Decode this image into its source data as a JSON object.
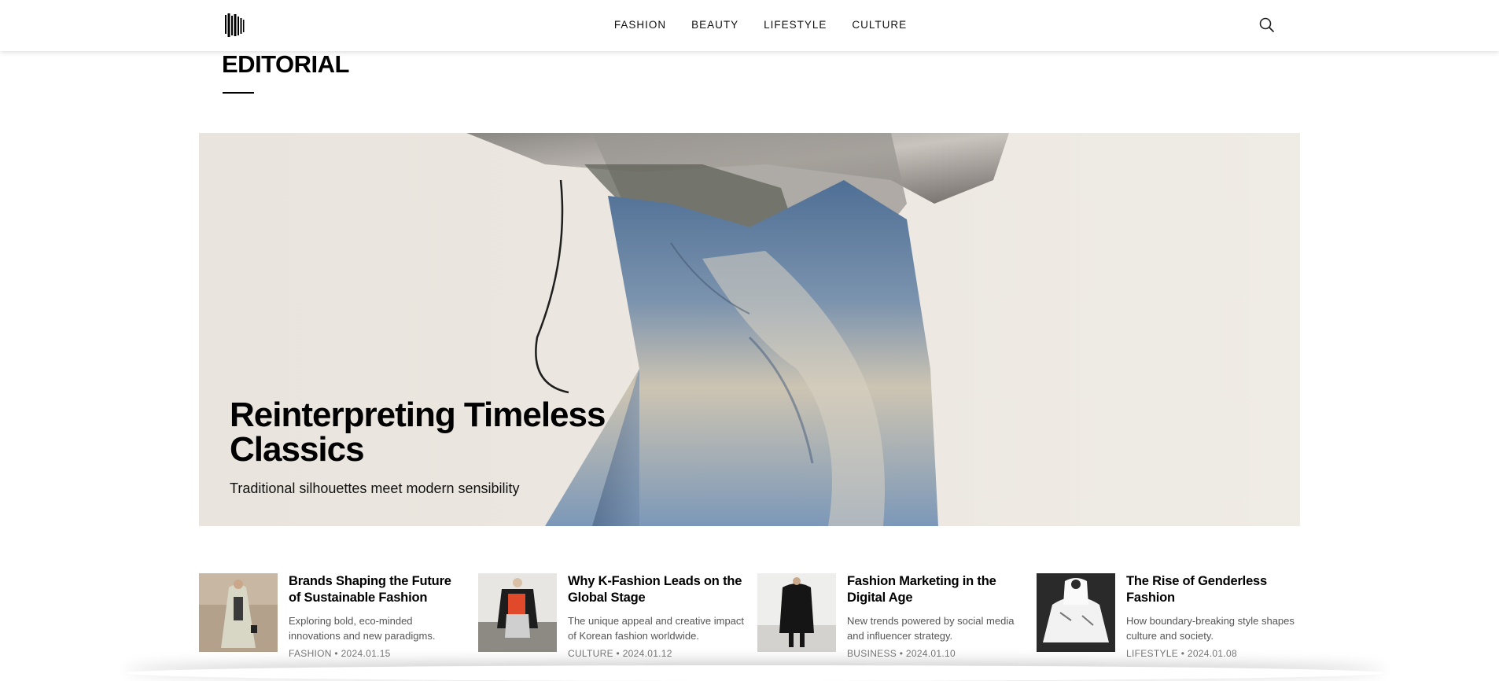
{
  "header": {
    "logo_icon": "barcode-stripes-logo",
    "nav": [
      {
        "label": "FASHION"
      },
      {
        "label": "BEAUTY"
      },
      {
        "label": "LIFESTYLE"
      },
      {
        "label": "CULTURE"
      }
    ],
    "search_icon": "search-icon"
  },
  "section": {
    "title": "EDITORIAL"
  },
  "hero": {
    "title": "Reinterpreting Timeless Classics",
    "subtitle": "Traditional silhouettes meet modern sensibility"
  },
  "articles": [
    {
      "title": "Brands Shaping the Future of Sustainable Fashion",
      "description": "Exploring bold, eco-minded innovations and new paradigms.",
      "category": "FASHION",
      "date": "2024.01.15"
    },
    {
      "title": "Why K-Fashion Leads on the Global Stage",
      "description": "The unique appeal and creative impact of Korean fashion worldwide.",
      "category": "CULTURE",
      "date": "2024.01.12"
    },
    {
      "title": "Fashion Marketing in the Digital Age",
      "description": "New trends powered by social media and influencer strategy.",
      "category": "BUSINESS",
      "date": "2024.01.10"
    },
    {
      "title": "The Rise of Genderless Fashion",
      "description": "How boundary-breaking style shapes culture and society.",
      "category": "LIFESTYLE",
      "date": "2024.01.08"
    }
  ],
  "meta_separator": "•",
  "colors": {
    "text": "#111111",
    "meta": "#777777",
    "hero_bg": "#ebe6e0",
    "denim": "#6f8fb5"
  }
}
